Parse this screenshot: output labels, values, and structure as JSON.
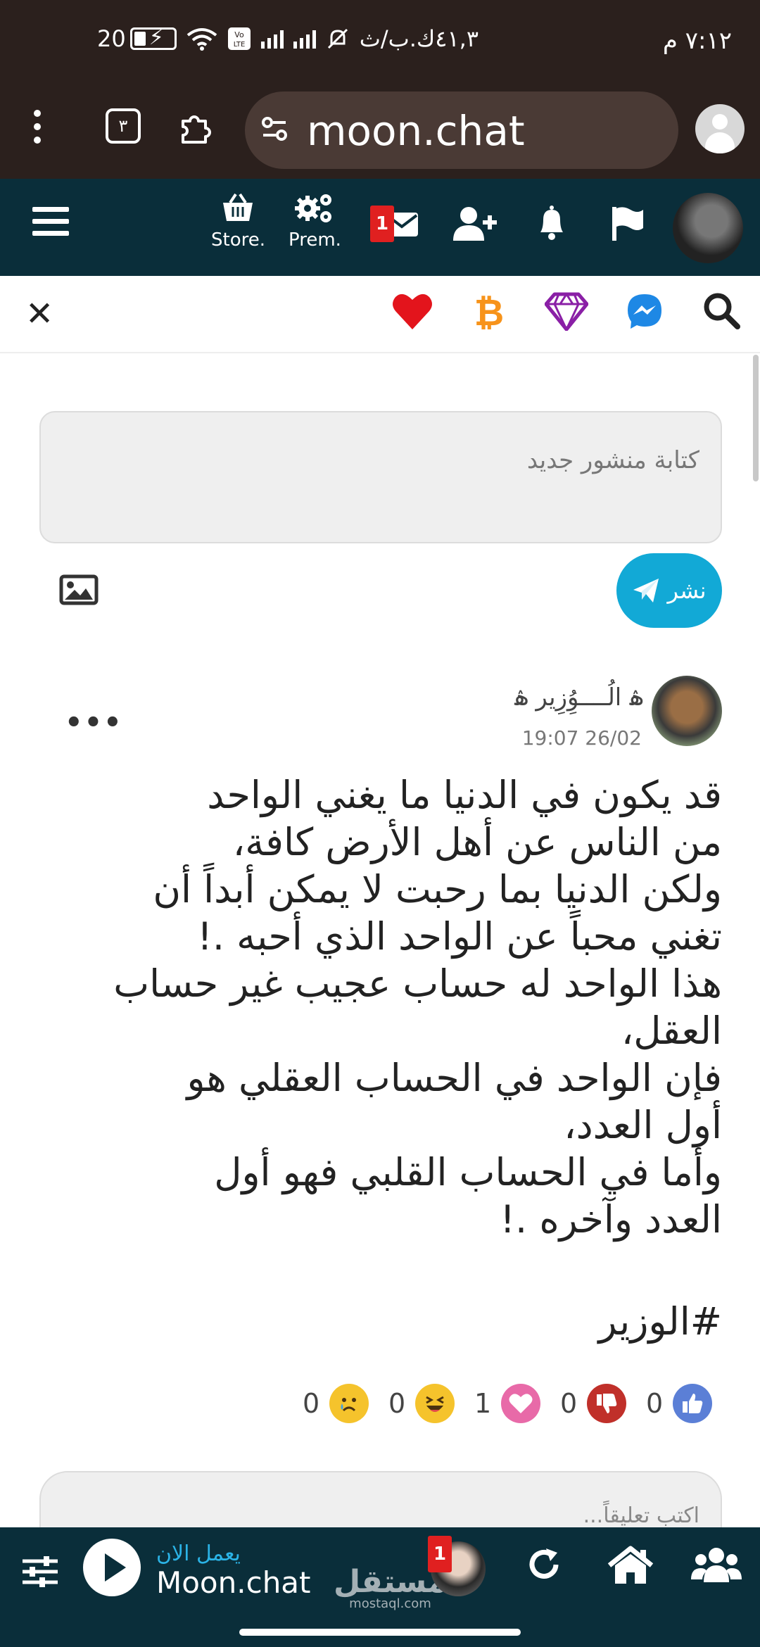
{
  "status_bar": {
    "time": "٧:١٢ م",
    "speed": "٤١,٣ك.ب/ث",
    "battery": "20",
    "icons": [
      "mute-icon",
      "signal-icon",
      "signal-icon",
      "volte-icon",
      "wifi-icon",
      "battery-charging-icon"
    ]
  },
  "browser": {
    "url": "moon.chat",
    "tab_count": "٣",
    "icons": [
      "more-vert-icon",
      "tabs-icon",
      "extension-icon",
      "site-settings-icon",
      "profile-icon"
    ]
  },
  "site_nav": {
    "store_label": "Store.",
    "premium_label": "Prem.",
    "messages_badge": "1",
    "icons": [
      "menu-icon",
      "basket-icon",
      "gears-icon",
      "envelope-icon",
      "add-user-icon",
      "bell-icon",
      "flag-icon",
      "avatar"
    ]
  },
  "quick_bar": {
    "icons": [
      "close-icon",
      "heart-icon",
      "bitcoin-icon",
      "diamond-icon",
      "messenger-icon",
      "search-icon"
    ],
    "colors": {
      "heart": "#e3141c",
      "bitcoin": "#f7931a",
      "diamond": "#8a1fa6",
      "messenger": "#1e88e5"
    }
  },
  "composer": {
    "placeholder": "كتابة منشور جديد",
    "post_button": "نشر"
  },
  "post": {
    "author": "ۿ الُــــوُِزِير ۿ",
    "date": "19:07 26/02",
    "body_lines": [
      "قد يكون في الدنيا ما يغني الواحد",
      "من الناس عن أهل الأرض كافة،",
      "ولكن الدنيا بما رحبت لا يمكن أبداً أن",
      "تغني محباً عن الواحد الذي أحبه .!",
      "هذا الواحد له حساب عجيب غير حساب",
      "العقل،",
      "فإن الواحد في الحساب العقلي هو",
      "أول العدد،",
      "وأما في الحساب القلبي فهو أول",
      "العدد وآخره .!"
    ],
    "hashtag": "#الوزير",
    "reactions": [
      {
        "name": "like",
        "count": "0",
        "color": "#5b7fd6"
      },
      {
        "name": "dislike",
        "count": "0",
        "color": "#c0302a"
      },
      {
        "name": "love",
        "count": "1",
        "color": "#e86aa8"
      },
      {
        "name": "haha",
        "count": "0",
        "color": "#f5c32c"
      },
      {
        "name": "sad",
        "count": "0",
        "color": "#f5c32c"
      }
    ],
    "comment_placeholder": "اكتب تعليقاً..."
  },
  "player": {
    "now_playing_label": "يعمل الان",
    "station": "Moon.chat",
    "dj_badge": "1",
    "watermark": "مستقل",
    "watermark_sub": "mostaql.com",
    "icons": [
      "equalizer-icon",
      "play-icon",
      "refresh-icon",
      "home-icon",
      "users-icon"
    ]
  }
}
